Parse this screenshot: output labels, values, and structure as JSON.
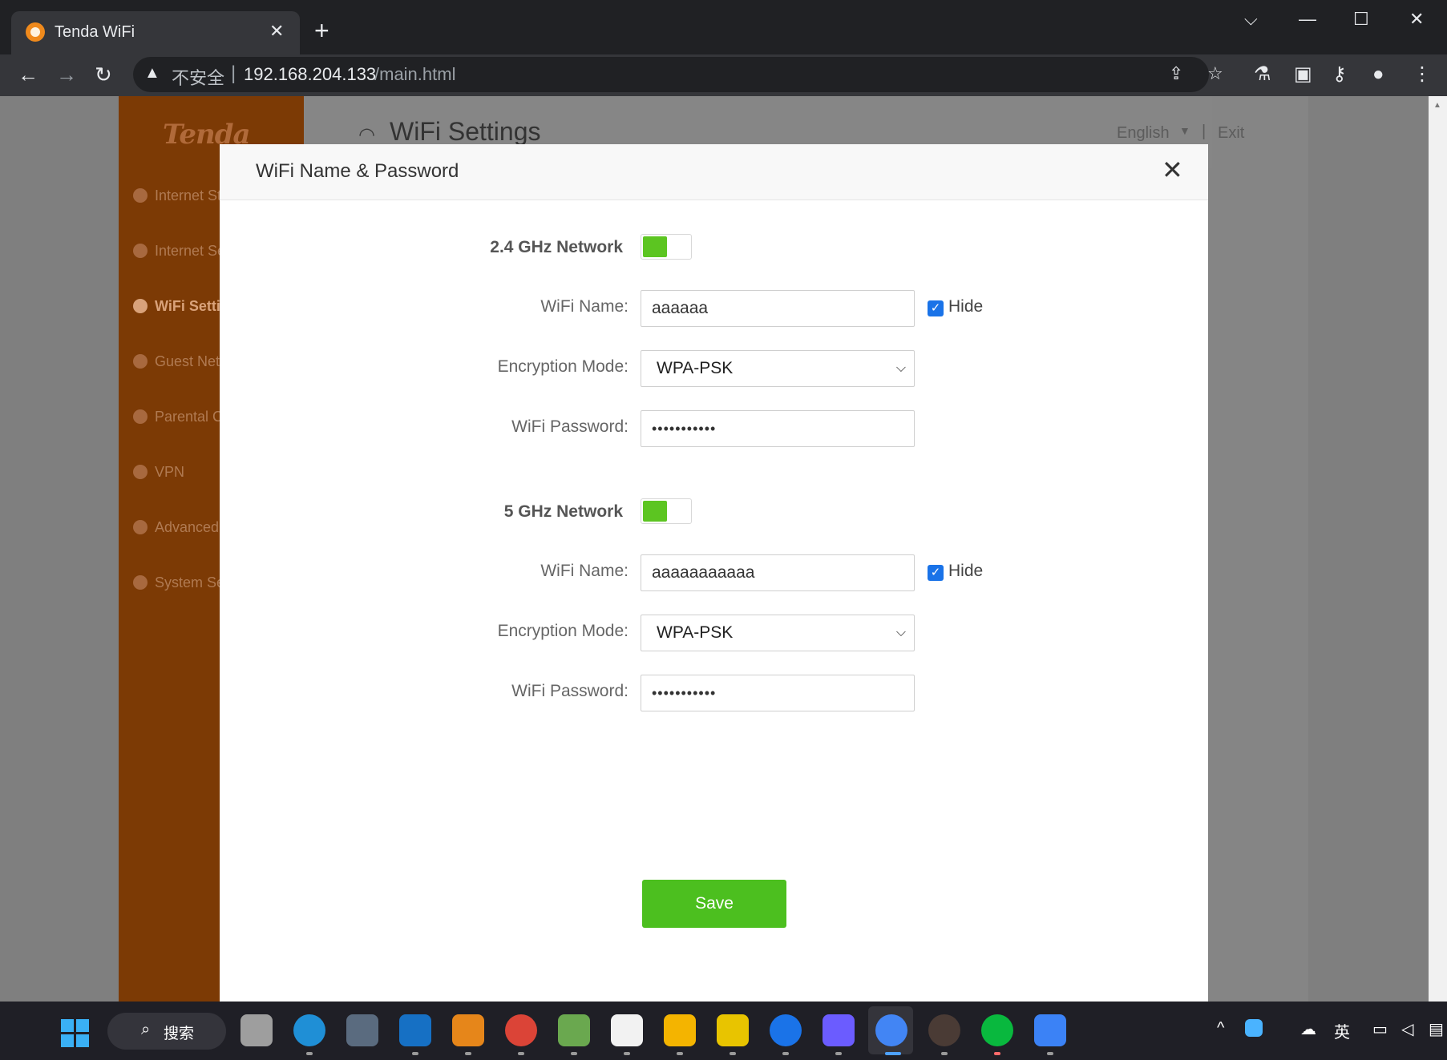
{
  "browser": {
    "tab_title": "Tenda WiFi",
    "tab_close": "✕",
    "new_tab": "+",
    "window_controls": {
      "dropdown": "⌵",
      "minimize": "—",
      "maximize": "☐",
      "close": "✕"
    },
    "nav": {
      "back": "←",
      "forward": "→",
      "reload": "↻"
    },
    "security_label": "不安全",
    "url_separator": "|",
    "url_host": "192.168.204.133",
    "url_path": "/main.html",
    "icons": [
      "share-icon",
      "star-icon",
      "labs-icon",
      "sidepanel-icon",
      "key-icon",
      "profile-icon",
      "menu-icon"
    ]
  },
  "page": {
    "logo": "Tenda",
    "title": "WiFi Settings",
    "language": "English",
    "header_separator": "|",
    "exit": "Exit",
    "sidebar": {
      "items": [
        {
          "label": "Internet St",
          "icon": "internet-status-icon"
        },
        {
          "label": "Internet Se",
          "icon": "globe-icon"
        },
        {
          "label": "WiFi Setti",
          "icon": "wifi-icon",
          "active": true
        },
        {
          "label": "Guest Net",
          "icon": "guest-icon"
        },
        {
          "label": "Parental C",
          "icon": "parental-icon"
        },
        {
          "label": "VPN",
          "icon": "vpn-icon"
        },
        {
          "label": "Advanced",
          "icon": "wrench-icon"
        },
        {
          "label": "System Se",
          "icon": "gear-icon"
        }
      ]
    }
  },
  "modal": {
    "title": "WiFi Name & Password",
    "close": "✕",
    "network_24": {
      "section_label": "2.4 GHz Network",
      "enabled": true,
      "name_label": "WiFi Name:",
      "name_value": "aaaaaa",
      "hide_label": "Hide",
      "hide_checked": true,
      "encryption_label": "Encryption Mode:",
      "encryption_value": "WPA-PSK",
      "password_label": "WiFi Password:",
      "password_value": "•••••••••••"
    },
    "network_5": {
      "section_label": "5 GHz Network",
      "enabled": true,
      "name_label": "WiFi Name:",
      "name_value": "aaaaaaaaaaa",
      "hide_label": "Hide",
      "hide_checked": true,
      "encryption_label": "Encryption Mode:",
      "encryption_value": "WPA-PSK",
      "password_label": "WiFi Password:",
      "password_value": "•••••••••••"
    },
    "save_label": "Save"
  },
  "taskbar": {
    "search_label": "搜索",
    "ime_label": "英",
    "colors": {
      "accent": "#4cbf1f",
      "sidebar": "#7c3a05",
      "toggle_on": "#5cc521",
      "checkbox": "#1a73e8"
    }
  }
}
